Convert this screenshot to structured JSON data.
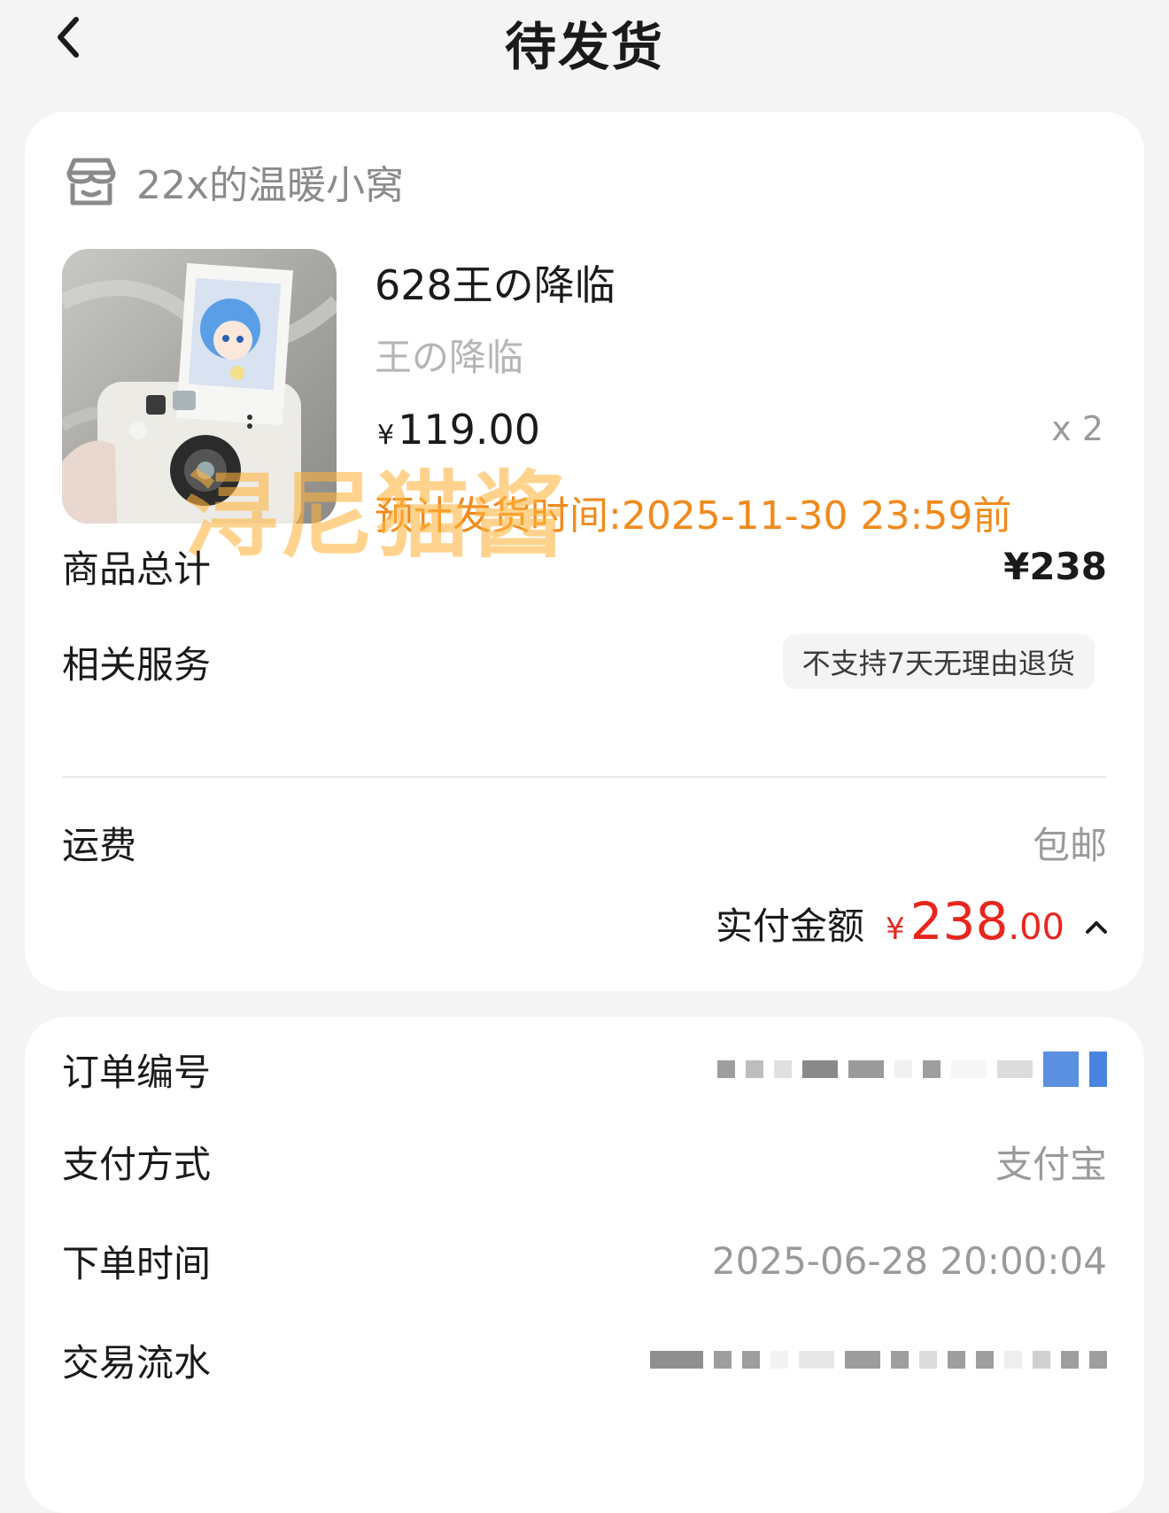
{
  "nav": {
    "title": "待发货",
    "back_icon": "chevron-left-icon"
  },
  "shop": {
    "name": "22x的温暖小窝",
    "icon": "store-icon"
  },
  "product": {
    "title": "628王の降临",
    "spec": "王の降临",
    "price_symbol": "¥",
    "price": "119.00",
    "quantity": "x 2",
    "ship_deadline": "预计发货时间:2025-11-30 23:59前",
    "watermark": "浔尼猫酱"
  },
  "summary": {
    "total_label": "商品总计",
    "total_value": "¥238",
    "service_label": "相关服务",
    "service_badge": "不支持7天无理由退货",
    "shipping_label": "运费",
    "shipping_value": "包邮",
    "paid_label": "实付金额",
    "paid_symbol": "¥",
    "paid_int": "238",
    "paid_dec": ".00"
  },
  "order": {
    "order_no_label": "订单编号",
    "pay_method_label": "支付方式",
    "pay_method_value": "支付宝",
    "order_time_label": "下单时间",
    "order_time_value": "2025-06-28 20:00:04",
    "txn_label": "交易流水"
  },
  "colors": {
    "price_red": "#e8261e",
    "warn_orange": "#f08a1c",
    "background": "#f4f4f4"
  }
}
